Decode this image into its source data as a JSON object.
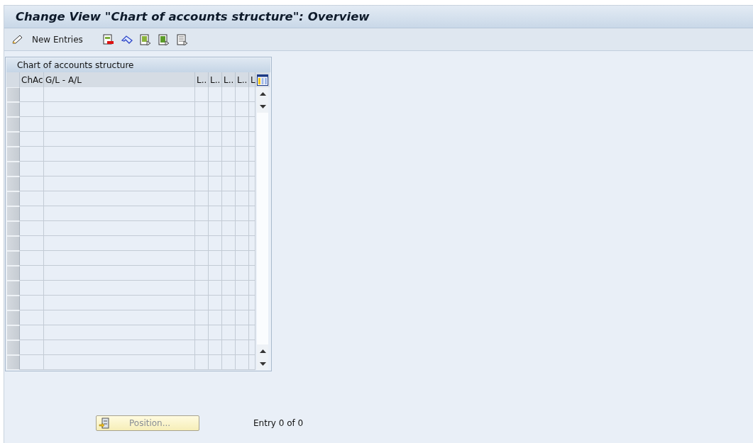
{
  "window": {
    "title": "Change View \"Chart of accounts structure\": Overview"
  },
  "toolbar": {
    "items": [
      {
        "kind": "text",
        "label": "New Entries"
      },
      {
        "kind": "icon"
      },
      {
        "kind": "icon"
      },
      {
        "kind": "icon"
      },
      {
        "kind": "icon"
      },
      {
        "kind": "icon"
      }
    ]
  },
  "table": {
    "title": "Chart of accounts structure",
    "columns": [
      "ChAc",
      "G/L - A/L",
      "L..",
      "L..",
      "L..",
      "L..",
      "L"
    ]
  },
  "footer": {
    "position_button": "Position...",
    "entry_info": "Entry 0 of 0"
  }
}
